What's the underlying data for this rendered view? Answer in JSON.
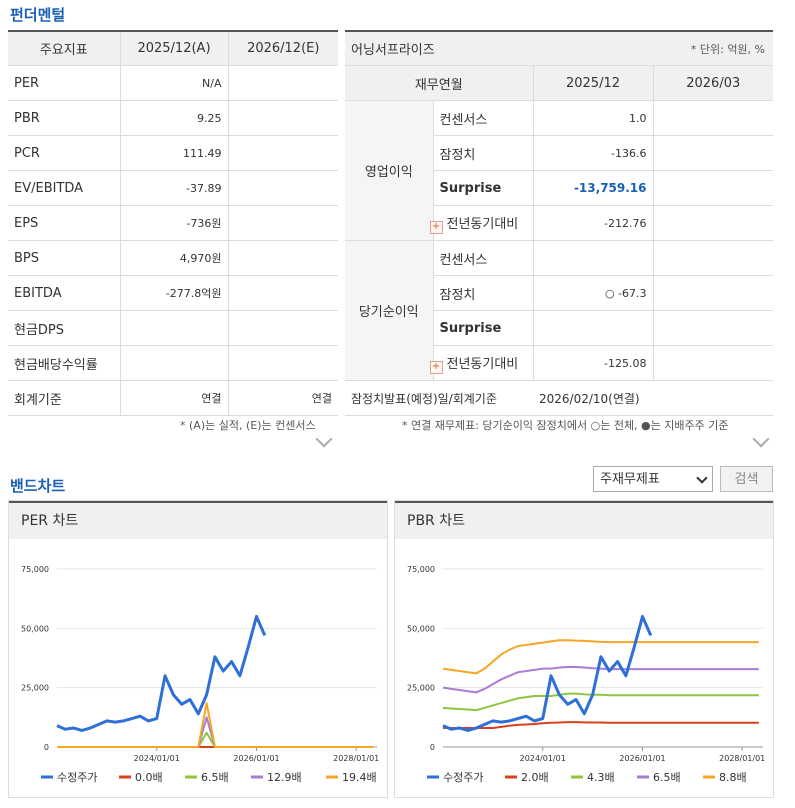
{
  "fundamental": {
    "title": "펀더멘털",
    "headers": [
      "주요지표",
      "2025/12(A)",
      "2026/12(E)"
    ],
    "rows": [
      {
        "label": "PER",
        "a": "N/A",
        "e": ""
      },
      {
        "label": "PBR",
        "a": "9.25",
        "e": ""
      },
      {
        "label": "PCR",
        "a": "111.49",
        "e": ""
      },
      {
        "label": "EV/EBITDA",
        "a": "-37.89",
        "e": ""
      },
      {
        "label": "EPS",
        "a": "-736원",
        "e": ""
      },
      {
        "label": "BPS",
        "a": "4,970원",
        "e": ""
      },
      {
        "label": "EBITDA",
        "a": "-277.8억원",
        "e": ""
      },
      {
        "label": "현금DPS",
        "a": "",
        "e": ""
      },
      {
        "label": "현금배당수익률",
        "a": "",
        "e": ""
      },
      {
        "label": "회계기준",
        "a": "연결",
        "e": "연결"
      }
    ],
    "note": "* (A)는 실적, (E)는 컨센서스"
  },
  "earnings": {
    "title": "어닝서프라이즈",
    "unit": "* 단위: 억원, %",
    "headers": [
      "재무연월",
      "2025/12",
      "2026/03"
    ],
    "group1": "영업이익",
    "group2": "당기순이익",
    "op_rows": [
      {
        "label": "컨센서스",
        "v1": "1.0",
        "v2": ""
      },
      {
        "label": "잠정치",
        "v1": "-136.6",
        "v2": ""
      },
      {
        "label": "Surprise",
        "v1": "-13,759.16",
        "v2": ""
      },
      {
        "label": "전년동기대비",
        "v1": "-212.76",
        "v2": ""
      }
    ],
    "net_rows": [
      {
        "label": "컨센서스",
        "v1": "",
        "v2": ""
      },
      {
        "label": "잠정치",
        "v1": "○ -67.3",
        "v2": ""
      },
      {
        "label": "Surprise",
        "v1": "",
        "v2": ""
      },
      {
        "label": "전년동기대비",
        "v1": "-125.08",
        "v2": ""
      }
    ],
    "plus_glyph": "+",
    "footer_label": "잠정치발표(예정)일/회계기준",
    "footer_value": "2026/02/10(연결)",
    "note": "* 연결 재무제표: 당기순이익 잠정치에서 ○는 전체, ●는 지배주주 기준"
  },
  "band": {
    "title": "밴드차트",
    "select_value": "주재무제표",
    "search_label": "검색"
  },
  "chart_data": [
    {
      "type": "line",
      "title": "PER 차트",
      "x": [
        "2022/01",
        "2022/03",
        "2022/05",
        "2022/07",
        "2022/09",
        "2022/11",
        "2023/01",
        "2023/03",
        "2023/05",
        "2023/07",
        "2023/09",
        "2023/11",
        "2024/01",
        "2024/03",
        "2024/05",
        "2024/07",
        "2024/09",
        "2024/11",
        "2025/01",
        "2025/03",
        "2025/05",
        "2025/07",
        "2025/09",
        "2025/11",
        "2026/01",
        "2026/03"
      ],
      "x_ticks": [
        "2024/01/01",
        "2026/01/01",
        "2028/01/01"
      ],
      "y_ticks": [
        "0",
        "25,000",
        "50,000",
        "75,000"
      ],
      "ylim": [
        0,
        75000
      ],
      "series": [
        {
          "name": "수정주가",
          "color": "#2e6fd8",
          "values": [
            9000,
            7500,
            8000,
            7000,
            8000,
            9500,
            11000,
            10500,
            11000,
            12000,
            13000,
            11000,
            12000,
            30000,
            22000,
            18000,
            20000,
            14000,
            22000,
            38000,
            32000,
            36000,
            30000,
            42000,
            55000,
            47000
          ]
        },
        {
          "name": "0.0배",
          "color": "#d9411e",
          "values": [
            0,
            0,
            0,
            0,
            0,
            0,
            0,
            0,
            0,
            0,
            0,
            0,
            0,
            0,
            0,
            0,
            0,
            0,
            0,
            0,
            0,
            0,
            0,
            0,
            0,
            0
          ]
        },
        {
          "name": "6.5배",
          "color": "#8cc63f",
          "values": [
            0,
            0,
            0,
            0,
            0,
            0,
            0,
            0,
            0,
            0,
            0,
            0,
            0,
            0,
            0,
            0,
            0,
            0,
            6000,
            0,
            0,
            0,
            0,
            0,
            0,
            0
          ]
        },
        {
          "name": "12.9배",
          "color": "#a97bd6",
          "values": [
            0,
            0,
            0,
            0,
            0,
            0,
            0,
            0,
            0,
            0,
            0,
            0,
            0,
            0,
            0,
            0,
            0,
            0,
            12500,
            0,
            0,
            0,
            0,
            0,
            0,
            0
          ]
        },
        {
          "name": "19.4배",
          "color": "#f5a623",
          "values": [
            0,
            0,
            0,
            0,
            0,
            0,
            0,
            0,
            0,
            0,
            0,
            0,
            0,
            0,
            0,
            0,
            0,
            0,
            18500,
            0,
            0,
            0,
            0,
            0,
            0,
            0
          ]
        }
      ]
    },
    {
      "type": "line",
      "title": "PBR 차트",
      "x": [
        "2022/01",
        "2022/03",
        "2022/05",
        "2022/07",
        "2022/09",
        "2022/11",
        "2023/01",
        "2023/03",
        "2023/05",
        "2023/07",
        "2023/09",
        "2023/11",
        "2024/01",
        "2024/03",
        "2024/05",
        "2024/07",
        "2024/09",
        "2024/11",
        "2025/01",
        "2025/03",
        "2025/05",
        "2025/07",
        "2025/09",
        "2025/11",
        "2026/01",
        "2026/03"
      ],
      "x_ticks": [
        "2024/01/01",
        "2026/01/01",
        "2028/01/01"
      ],
      "y_ticks": [
        "0",
        "25,000",
        "50,000",
        "75,000"
      ],
      "ylim": [
        0,
        75000
      ],
      "series": [
        {
          "name": "수정주가",
          "color": "#2e6fd8",
          "values": [
            9000,
            7500,
            8000,
            7000,
            8000,
            9500,
            11000,
            10500,
            11000,
            12000,
            13000,
            11000,
            12000,
            30000,
            22000,
            18000,
            20000,
            14000,
            22000,
            38000,
            32000,
            36000,
            30000,
            42000,
            55000,
            47000
          ]
        },
        {
          "name": "2.0배",
          "color": "#d9411e",
          "values": [
            8000,
            8000,
            8000,
            8000,
            8000,
            8000,
            8000,
            8500,
            9000,
            9300,
            9500,
            9700,
            10000,
            10200,
            10300,
            10500,
            10500,
            10400,
            10300,
            10300,
            10200,
            10200,
            10200,
            10200,
            10200,
            10200
          ]
        },
        {
          "name": "4.3배",
          "color": "#8cc63f",
          "values": [
            16500,
            16200,
            16000,
            15800,
            15500,
            16500,
            17500,
            18500,
            19500,
            20500,
            21000,
            21500,
            21500,
            21500,
            22000,
            22500,
            22500,
            22200,
            22000,
            22000,
            21800,
            21800,
            21800,
            21800,
            21800,
            21800
          ]
        },
        {
          "name": "6.5배",
          "color": "#a97bd6",
          "values": [
            25000,
            24500,
            24000,
            23500,
            23000,
            24500,
            26500,
            28500,
            30000,
            31500,
            32000,
            32500,
            33000,
            33000,
            33500,
            33700,
            33700,
            33500,
            33200,
            33000,
            32800,
            32800,
            32800,
            32800,
            32800,
            32800
          ]
        },
        {
          "name": "8.8배",
          "color": "#f5a623",
          "values": [
            33000,
            32500,
            32000,
            31500,
            31000,
            33000,
            36000,
            39000,
            41000,
            42500,
            43000,
            43500,
            44000,
            44500,
            45000,
            45000,
            44800,
            44700,
            44500,
            44300,
            44200,
            44200,
            44200,
            44200,
            44200,
            44200
          ]
        }
      ]
    }
  ]
}
